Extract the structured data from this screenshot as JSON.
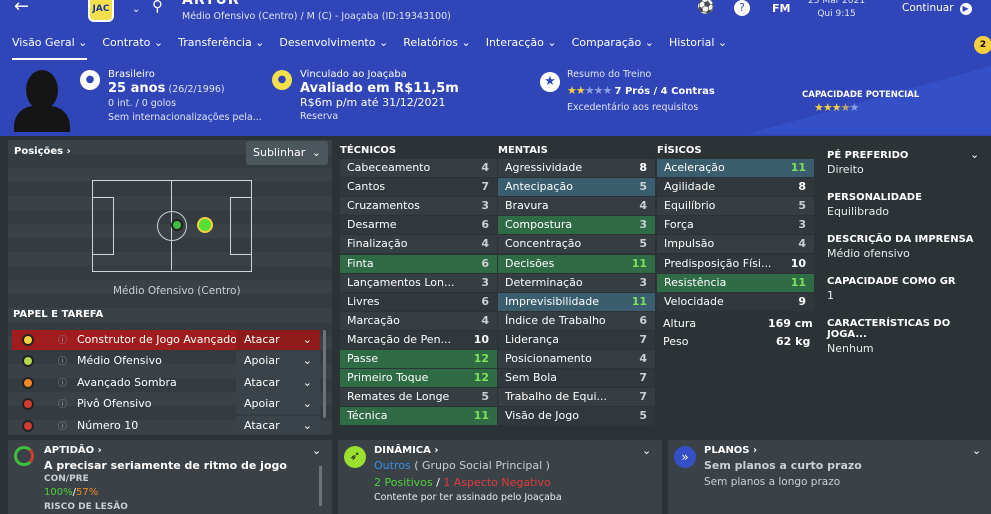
{
  "header": {
    "back": "←",
    "crest": "JAC",
    "name": "ARTUR",
    "subtitle": "Médio Ofensivo (Centro) / M (C) - Joaçaba (ID:19343100)",
    "fm": "FM",
    "date_line1": "25 Mar 2021",
    "date_line2": "Qui 9:15",
    "continue": "Continuar",
    "badge": "2"
  },
  "nav": [
    "Visão Geral",
    "Contrato",
    "Transferência",
    "Desenvolvimento",
    "Relatórios",
    "Interacção",
    "Comparação",
    "Historial"
  ],
  "info": {
    "nation": "Brasileiro",
    "age": "25 anos",
    "dob": "(26/2/1996)",
    "intl": "0 int. / 0 golos",
    "intl2": "Sem internacionalizações pela...",
    "club_line": "Vinculado ao Joaçaba",
    "value": "Avaliado em R$11,5m",
    "wage": "R$6m p/m até 31/12/2021",
    "squad": "Reserva",
    "training_title": "Resumo do Treino",
    "training_score": "7 Prós / 4 Contras",
    "training_desc": "Excedentário aos requisitos",
    "potential_label": "CAPACIDADE POTENCIAL"
  },
  "positions": {
    "title": "Posições ›",
    "highlight": "Sublinhar",
    "position_name": "Médio Ofensivo (Centro)",
    "roles_title": "PAPEL E TAREFA"
  },
  "roles": [
    {
      "name": "Construtor de Jogo Avançado",
      "duty": "Atacar",
      "color": "#f4d03f"
    },
    {
      "name": "Médio Ofensivo",
      "duty": "Apoiar",
      "color": "#b7d84a"
    },
    {
      "name": "Avançado Sombra",
      "duty": "Atacar",
      "color": "#f08a24"
    },
    {
      "name": "Pivô Ofensivo",
      "duty": "Apoiar",
      "color": "#d23b2f"
    },
    {
      "name": "Número 10",
      "duty": "Atacar",
      "color": "#d23b2f"
    }
  ],
  "technical": {
    "title": "TÉCNICOS",
    "rows": [
      [
        "Cabeceamento",
        "4"
      ],
      [
        "Cantos",
        "7"
      ],
      [
        "Cruzamentos",
        "3"
      ],
      [
        "Desarme",
        "6"
      ],
      [
        "Finalização",
        "4"
      ],
      [
        "Finta",
        "6"
      ],
      [
        "Lançamentos Lon...",
        "3"
      ],
      [
        "Livres",
        "6"
      ],
      [
        "Marcação",
        "4"
      ],
      [
        "Marcação de Pen...",
        "10"
      ],
      [
        "Passe",
        "12"
      ],
      [
        "Primeiro Toque",
        "12"
      ],
      [
        "Remates de Longe",
        "5"
      ],
      [
        "Técnica",
        "11"
      ]
    ]
  },
  "mental": {
    "title": "MENTAIS",
    "rows": [
      [
        "Agressividade",
        "8"
      ],
      [
        "Antecipação",
        "5"
      ],
      [
        "Bravura",
        "4"
      ],
      [
        "Compostura",
        "3"
      ],
      [
        "Concentração",
        "5"
      ],
      [
        "Decisões",
        "11"
      ],
      [
        "Determinação",
        "3"
      ],
      [
        "Imprevisibilidade",
        "11"
      ],
      [
        "Índice de Trabalho",
        "6"
      ],
      [
        "Liderança",
        "7"
      ],
      [
        "Posicionamento",
        "4"
      ],
      [
        "Sem Bola",
        "7"
      ],
      [
        "Trabalho de Equi...",
        "7"
      ],
      [
        "Visão de Jogo",
        "5"
      ]
    ]
  },
  "physical": {
    "title": "FÍSICOS",
    "rows": [
      [
        "Aceleração",
        "11"
      ],
      [
        "Agilidade",
        "8"
      ],
      [
        "Equilíbrio",
        "5"
      ],
      [
        "Força",
        "3"
      ],
      [
        "Impulsão",
        "4"
      ],
      [
        "Predisposição Físi...",
        "10"
      ],
      [
        "Resistência",
        "11"
      ],
      [
        "Velocidade",
        "9"
      ]
    ],
    "height_label": "Altura",
    "height": "169 cm",
    "weight_label": "Peso",
    "weight": "62 kg"
  },
  "side": [
    [
      "PÉ PREFERIDO",
      "Direito"
    ],
    [
      "PERSONALIDADE",
      "Equilibrado"
    ],
    [
      "DESCRIÇÃO DA IMPRENSA",
      "Médio ofensivo"
    ],
    [
      "CAPACIDADE COMO GR",
      "1"
    ],
    [
      "CARACTERÍSTICAS DO JOGA...",
      "Nenhum"
    ]
  ],
  "fitness": {
    "title": "APTIDÃO ›",
    "text": "A precisar seriamente de ritmo de jogo",
    "con_label": "CON/PRE",
    "con": "100%",
    "pre": "57%",
    "injury": "RISCO DE LESÃO"
  },
  "dynamics": {
    "title": "DINÂMICA ›",
    "group": "Outros",
    "group_desc": "( Grupo Social Principal )",
    "pos": "2 Positivos",
    "neg": "1 Aspecto Negativo",
    "note": "Contente por ter assinado pelo Joaçaba"
  },
  "plans": {
    "title": "PLANOS ›",
    "text": "Sem planos a curto prazo",
    "text2": "Sem planos a longo prazo"
  }
}
